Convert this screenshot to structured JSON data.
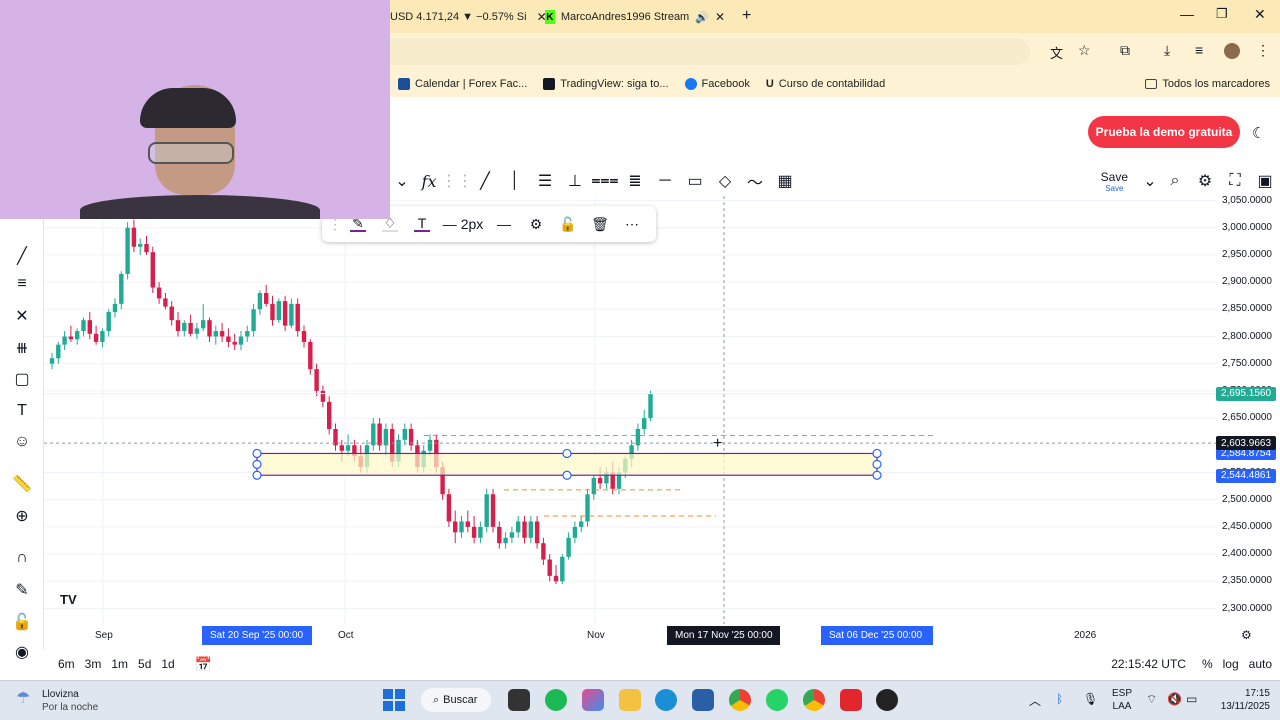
{
  "browser": {
    "tabs": [
      {
        "label": "USD 4.171,24 ▼ −0.57% Si",
        "favicon": "tradingview-icon"
      },
      {
        "label": "MarcoAndres1996 Stream",
        "favicon": "kick-icon"
      }
    ],
    "bookmarks": [
      {
        "label": "Calendar | Forex Fac...",
        "color": "#1c4e9a"
      },
      {
        "label": "TradingView: siga to...",
        "color": "#131722"
      },
      {
        "label": "Facebook",
        "color": "#1877f2"
      },
      {
        "label": "Curso de contabilidad",
        "color": "#1a1a1a"
      }
    ],
    "all_bookmarks": "Todos los marcadores"
  },
  "tradingview": {
    "demo_button": "Prueba la demo gratuita",
    "save_label": "Save",
    "save_sub": "Save",
    "fx_label": "f",
    "float_toolbar": {
      "width_label": "2px"
    },
    "brand_mark": "TV"
  },
  "chart": {
    "y_ticks": [
      "3,050.0000",
      "3,000.0000",
      "2,950.0000",
      "2,900.0000",
      "2,850.0000",
      "2,800.0000",
      "2,750.0000",
      "2,700.0000",
      "2,650.0000",
      "2,600.0000",
      "2,550.0000",
      "2,500.0000",
      "2,450.0000",
      "2,400.0000",
      "2,350.0000",
      "2,300.0000"
    ],
    "price_tags": {
      "level_top": "2,695.1560",
      "cursor": "2,603.9663",
      "box_top": "2,584.8754",
      "box_bottom": "2,544.4861"
    },
    "x_ticks": [
      "Sep",
      "Oct",
      "Nov",
      "2026"
    ],
    "x_highlights": [
      "Sat 20 Sep '25   00:00",
      "Mon 17 Nov '25   00:00",
      "Sat 06 Dec '25   00:00"
    ],
    "colors": {
      "up": "#22ab94",
      "down": "#d81e4b",
      "box": "#7b1fa2",
      "dash": "#f08c28",
      "accent": "#2962ff"
    }
  },
  "chart_data": {
    "type": "candlestick",
    "ylim": [
      2290,
      3060
    ],
    "candles": [
      [
        2750,
        2770,
        2740,
        2760
      ],
      [
        2760,
        2790,
        2750,
        2785
      ],
      [
        2785,
        2810,
        2775,
        2800
      ],
      [
        2800,
        2820,
        2790,
        2795
      ],
      [
        2795,
        2815,
        2785,
        2810
      ],
      [
        2810,
        2835,
        2800,
        2830
      ],
      [
        2830,
        2845,
        2795,
        2805
      ],
      [
        2805,
        2820,
        2785,
        2790
      ],
      [
        2790,
        2815,
        2780,
        2810
      ],
      [
        2810,
        2850,
        2800,
        2845
      ],
      [
        2845,
        2870,
        2835,
        2860
      ],
      [
        2860,
        2920,
        2850,
        2915
      ],
      [
        2915,
        3010,
        2905,
        3000
      ],
      [
        3000,
        3015,
        2955,
        2965
      ],
      [
        2965,
        2980,
        2950,
        2970
      ],
      [
        2970,
        2985,
        2950,
        2955
      ],
      [
        2955,
        2965,
        2880,
        2890
      ],
      [
        2890,
        2900,
        2860,
        2870
      ],
      [
        2870,
        2880,
        2850,
        2855
      ],
      [
        2855,
        2865,
        2820,
        2830
      ],
      [
        2830,
        2845,
        2800,
        2810
      ],
      [
        2810,
        2830,
        2800,
        2825
      ],
      [
        2825,
        2840,
        2800,
        2805
      ],
      [
        2805,
        2825,
        2795,
        2815
      ],
      [
        2815,
        2860,
        2810,
        2830
      ],
      [
        2830,
        2835,
        2790,
        2800
      ],
      [
        2800,
        2820,
        2785,
        2810
      ],
      [
        2810,
        2825,
        2790,
        2800
      ],
      [
        2800,
        2815,
        2780,
        2790
      ],
      [
        2790,
        2805,
        2775,
        2785
      ],
      [
        2785,
        2810,
        2775,
        2800
      ],
      [
        2800,
        2820,
        2790,
        2810
      ],
      [
        2810,
        2860,
        2800,
        2850
      ],
      [
        2850,
        2885,
        2840,
        2880
      ],
      [
        2880,
        2895,
        2855,
        2860
      ],
      [
        2860,
        2875,
        2820,
        2830
      ],
      [
        2830,
        2870,
        2825,
        2865
      ],
      [
        2865,
        2875,
        2810,
        2820
      ],
      [
        2820,
        2870,
        2815,
        2860
      ],
      [
        2860,
        2870,
        2800,
        2810
      ],
      [
        2810,
        2820,
        2780,
        2790
      ],
      [
        2790,
        2795,
        2730,
        2740
      ],
      [
        2740,
        2750,
        2690,
        2700
      ],
      [
        2700,
        2710,
        2670,
        2680
      ],
      [
        2680,
        2690,
        2620,
        2630
      ],
      [
        2630,
        2640,
        2590,
        2600
      ],
      [
        2600,
        2610,
        2570,
        2590
      ],
      [
        2590,
        2620,
        2580,
        2600
      ],
      [
        2600,
        2610,
        2570,
        2580
      ],
      [
        2580,
        2600,
        2550,
        2560
      ],
      [
        2560,
        2610,
        2550,
        2600
      ],
      [
        2600,
        2650,
        2590,
        2640
      ],
      [
        2640,
        2650,
        2590,
        2600
      ],
      [
        2600,
        2640,
        2580,
        2630
      ],
      [
        2630,
        2640,
        2560,
        2570
      ],
      [
        2570,
        2620,
        2560,
        2610
      ],
      [
        2610,
        2640,
        2600,
        2630
      ],
      [
        2630,
        2640,
        2590,
        2600
      ],
      [
        2600,
        2610,
        2550,
        2560
      ],
      [
        2560,
        2600,
        2550,
        2590
      ],
      [
        2590,
        2620,
        2580,
        2610
      ],
      [
        2610,
        2620,
        2550,
        2560
      ],
      [
        2560,
        2570,
        2500,
        2510
      ],
      [
        2510,
        2520,
        2450,
        2460
      ],
      [
        2460,
        2480,
        2420,
        2440
      ],
      [
        2440,
        2470,
        2430,
        2460
      ],
      [
        2460,
        2480,
        2440,
        2450
      ],
      [
        2450,
        2470,
        2420,
        2430
      ],
      [
        2430,
        2460,
        2420,
        2450
      ],
      [
        2450,
        2520,
        2440,
        2510
      ],
      [
        2510,
        2520,
        2440,
        2450
      ],
      [
        2450,
        2460,
        2410,
        2420
      ],
      [
        2420,
        2440,
        2410,
        2430
      ],
      [
        2430,
        2450,
        2420,
        2440
      ],
      [
        2440,
        2470,
        2430,
        2460
      ],
      [
        2460,
        2470,
        2420,
        2430
      ],
      [
        2430,
        2470,
        2420,
        2460
      ],
      [
        2460,
        2470,
        2410,
        2420
      ],
      [
        2420,
        2430,
        2380,
        2390
      ],
      [
        2390,
        2400,
        2350,
        2360
      ],
      [
        2360,
        2380,
        2345,
        2350
      ],
      [
        2350,
        2400,
        2345,
        2395
      ],
      [
        2395,
        2440,
        2390,
        2430
      ],
      [
        2430,
        2460,
        2420,
        2450
      ],
      [
        2450,
        2470,
        2440,
        2460
      ],
      [
        2460,
        2520,
        2450,
        2510
      ],
      [
        2510,
        2545,
        2500,
        2540
      ],
      [
        2540,
        2560,
        2520,
        2530
      ],
      [
        2530,
        2560,
        2520,
        2550
      ],
      [
        2550,
        2570,
        2510,
        2520
      ],
      [
        2520,
        2560,
        2510,
        2550
      ],
      [
        2550,
        2580,
        2540,
        2575
      ],
      [
        2575,
        2610,
        2560,
        2600
      ],
      [
        2600,
        2640,
        2590,
        2630
      ],
      [
        2630,
        2665,
        2620,
        2650
      ],
      [
        2650,
        2700,
        2645,
        2695
      ]
    ]
  },
  "status": {
    "time": "22:15:42 UTC",
    "percent": "%",
    "log": "log",
    "auto": "auto"
  },
  "timeframes": [
    "6m",
    "3m",
    "1m",
    "5d",
    "1d"
  ],
  "taskbar": {
    "weather_title": "Llovizna",
    "weather_sub": "Por la noche",
    "search": "Buscar",
    "lang1": "ESP",
    "lang2": "LAA",
    "time": "17:15",
    "date": "13/11/2025"
  }
}
